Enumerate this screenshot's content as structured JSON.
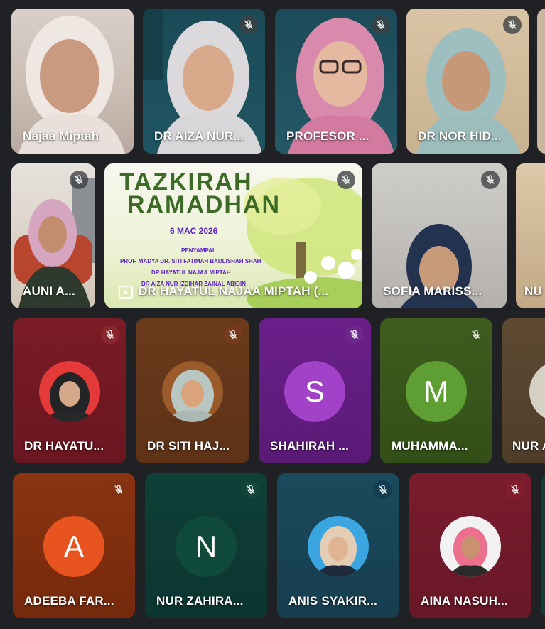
{
  "participants_row1": [
    {
      "name": "Najaa Miptah",
      "muted": false
    },
    {
      "name": "DR AIZA NUR...",
      "muted": true
    },
    {
      "name": "PROFESOR ...",
      "muted": true
    },
    {
      "name": "DR NOR HID...",
      "muted": true
    }
  ],
  "participants_row2": [
    {
      "name": "AUNI A...",
      "muted": true
    },
    {
      "name": "DR HAYATUL NAJAA MIPTAH (...",
      "muted": true,
      "presenting": true
    },
    {
      "name": "SOFIA MARISS...",
      "muted": true
    },
    {
      "name": "NU",
      "muted": false
    }
  ],
  "presentation": {
    "title_line1": "TAZKIRAH",
    "title_line2": "RAMADHAN",
    "date": "6 MAC 2026",
    "speakers_label": "PENYAMPAI:",
    "speaker1": "PROF. MADYA DR. SITI FATIMAH BADLISHAH SHAH",
    "speaker2": "DR HAYATUL NAJAA MIPTAH",
    "speaker3": "DR AIZA NUR IZDIHAR ZAINAL ABIDIN"
  },
  "participants_row3": [
    {
      "name": "DR HAYATU...",
      "muted": true,
      "avatar": "photo"
    },
    {
      "name": "DR SITI HAJ...",
      "muted": true,
      "avatar": "photo"
    },
    {
      "name": "SHAHIRAH ...",
      "muted": true,
      "avatar_letter": "S"
    },
    {
      "name": "MUHAMMA...",
      "muted": true,
      "avatar_letter": "M"
    },
    {
      "name": "NUR A",
      "muted": false,
      "avatar": "photo"
    }
  ],
  "participants_row4": [
    {
      "name": "ADEEBA FAR...",
      "muted": true,
      "avatar_letter": "A"
    },
    {
      "name": "NUR ZAHIRA...",
      "muted": true,
      "avatar_letter": "N"
    },
    {
      "name": "ANIS SYAKIR...",
      "muted": true,
      "avatar": "photo"
    },
    {
      "name": "AINA NASUH...",
      "muted": true,
      "avatar": "photo"
    }
  ],
  "colors": {
    "background": "#202124",
    "tile_maroon": "#7a1c26",
    "tile_brown": "#6b3a1c",
    "tile_purple": "#6a1f8a",
    "tile_olive": "#3e5d1e",
    "tile_rust": "#8a3410",
    "tile_teal_dark": "#0f4038",
    "tile_blue_teal": "#1b4a5c",
    "avatar_purple": "#a142c8",
    "avatar_green": "#5f9e32",
    "avatar_orange": "#e8541f",
    "avatar_teal": "#0f4a3a"
  },
  "icons": {
    "mute": "mic-off-icon",
    "present": "present-screen-icon"
  }
}
